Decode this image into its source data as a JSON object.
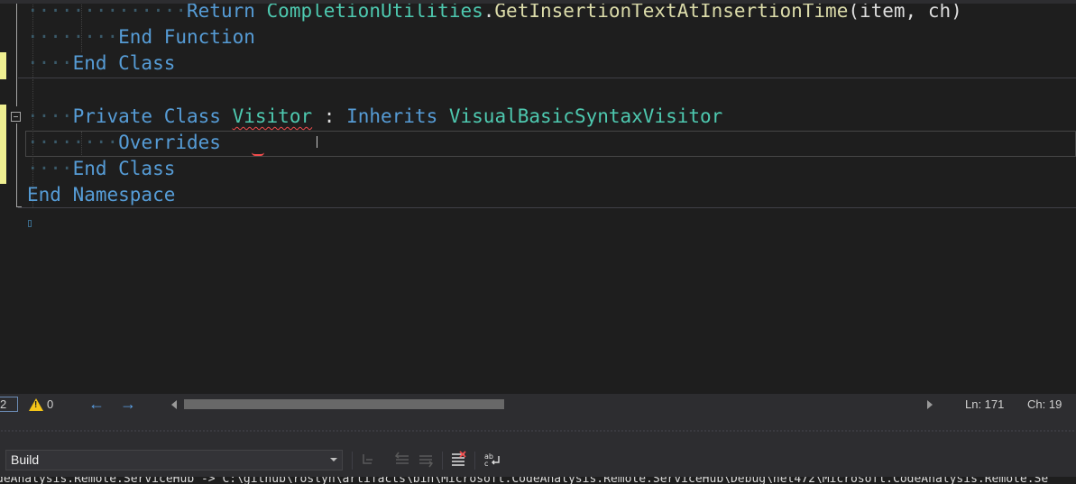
{
  "editor": {
    "lines": {
      "return_kw": "Return",
      "return_obj": "CompletionUtilities",
      "return_dot": ".",
      "return_fn": "GetInsertionTextAtInsertionTime",
      "return_args": "(item, ch)",
      "end_function": "End Function",
      "end_class_1": "End Class",
      "private_kw": "Private Class",
      "visitor_name": "Visitor",
      "colon": " : ",
      "inherits_kw": "Inherits",
      "base_type": "VisualBasicSyntaxVisitor",
      "overrides_kw": "Overrides",
      "end_class_2": "End Class",
      "end_namespace": "End Namespace"
    }
  },
  "statusbar": {
    "zoom": "2",
    "warnings": "0",
    "line": "Ln: 171",
    "col": "Ch: 19"
  },
  "output": {
    "source_selected": "Build",
    "text": "deAnalysis.Remote.ServiceHub -> C:\\github\\roslyn\\artifacts\\bin\\Microsoft.CodeAnalysis.Remote.ServiceHub\\Debug\\net472\\Microsoft.CodeAnalysis.Remote.Se"
  },
  "colors": {
    "keyword": "#569cd6",
    "type": "#4ec9b0",
    "function": "#dcdcaa",
    "error_squiggle": "#f14c4c",
    "change_bar": "#efef91"
  }
}
